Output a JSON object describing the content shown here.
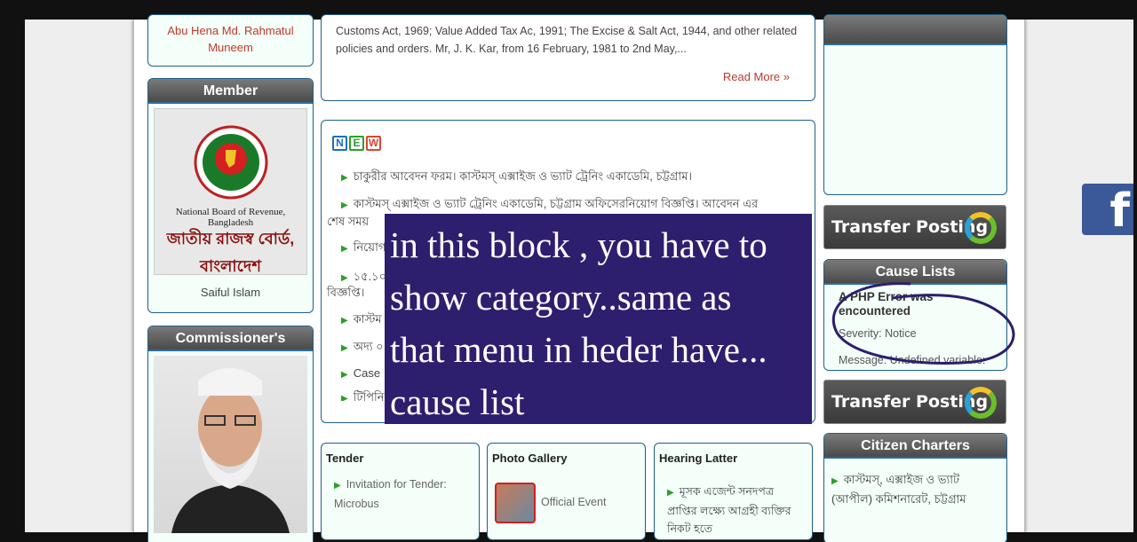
{
  "left": {
    "top_name": "Abu Hena Md. Rahmatul Muneem",
    "member": {
      "title": "Member",
      "logo_text_en": "National Board of Revenue, Bangladesh",
      "logo_text_bn": "জাতীয় রাজস্ব বোর্ড, বাংলাদেশ",
      "name": "Saiful Islam"
    },
    "commissioner": {
      "title": "Commissioner's"
    }
  },
  "center": {
    "intro_text": "Customs Act, 1969; Value Added Tax Ac, 1991; The Excise & Salt Act, 1944, and other related policies and orders. Mr, J. K. Kar, from 16 February, 1981 to 2nd May,...",
    "read_more": "Read More »",
    "new_letters": [
      "N",
      "E",
      "W"
    ],
    "news": [
      "চাকুরীর আবেদন ফরম। কাস্টমস্ এক্সাইজ ও ভ্যাট ট্রেনিং একাডেমি, চট্টগ্রাম।",
      "কাস্টমস্ এক্সাইজ ও ভ্যাট ট্রেনিং একাডেমি, চট্টগ্রাম অফিসেরনিয়োগ বিজ্ঞপ্তি। আবেদন এর",
      "শেষ সময়",
      "নিয়োগ",
      "১৫.১০",
      "বিজ্ঞপ্তি।",
      "কাস্টম",
      "অদ্য ০",
      "Case",
      "টিপিনি"
    ],
    "tender": {
      "title": "Tender",
      "item": "Invitation for Tender: Microbus"
    },
    "gallery": {
      "title": "Photo Gallery",
      "item": "Official Event"
    },
    "hearing": {
      "title": "Hearing Latter",
      "item": "মূসক এজেন্ট সনদপত্র প্রাপ্তির লক্ষ্যে আগ্রহী ব্যক্তির নিকট হতে"
    }
  },
  "right": {
    "transfer_label": "Transfer Posting",
    "cause_lists": {
      "title": "Cause Lists",
      "error_title": "A PHP Error was encountered",
      "severity": "Severity: Notice",
      "message": "Message: Undefined variable:"
    },
    "citizen": {
      "title": "Citizen Charters",
      "item": "কাস্টমস্, এক্সাইজ ও ভ্যাট (আপীল) কমিশনারেট, চট্টগ্রাম"
    }
  },
  "overlay": {
    "line1": "in this block , you have to",
    "line2": "show category..same as",
    "line3": "that menu in heder have...",
    "line4": "cause list"
  },
  "colors": {
    "accent_green": "#2aa02a",
    "border_blue": "#1f5f8a",
    "overlay_bg": "#2e1e6e",
    "annotation": "#2e1e6e",
    "link_red": "#c0392b"
  },
  "icons": {
    "facebook": "facebook-icon",
    "refresh": "refresh-icon",
    "bullet": "triangle-bullet-icon"
  }
}
